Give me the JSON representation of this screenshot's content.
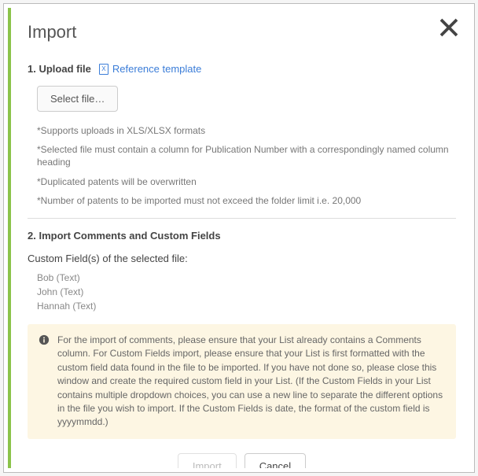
{
  "title": "Import",
  "step1": {
    "label": "1. Upload file",
    "reference_link": "Reference template",
    "select_button": "Select file…",
    "notes": [
      "*Supports uploads in XLS/XLSX formats",
      "*Selected file must contain a column for Publication Number with a correspondingly named column heading",
      "*Duplicated patents will be overwritten",
      "*Number of patents to be imported must not exceed the folder limit i.e. 20,000"
    ]
  },
  "step2": {
    "label": "2. Import Comments and Custom Fields",
    "subhead": "Custom Field(s) of the selected file:",
    "fields": [
      "Bob (Text)",
      "John (Text)",
      "Hannah (Text)"
    ],
    "info_text": "For the import of comments, please ensure that your List already contains a Comments column. For Custom Fields import, please ensure that your List is first formatted with the custom field data found in the file to be imported. If you have not done so, please close this window and create the required custom field in your List. (If the Custom Fields in your List contains multiple dropdown choices, you can use a new line to separate the different options in the file you wish to import. If the Custom Fields is date, the format of the custom field is yyyymmdd.)"
  },
  "actions": {
    "import_label": "Import",
    "cancel_label": "Cancel"
  }
}
